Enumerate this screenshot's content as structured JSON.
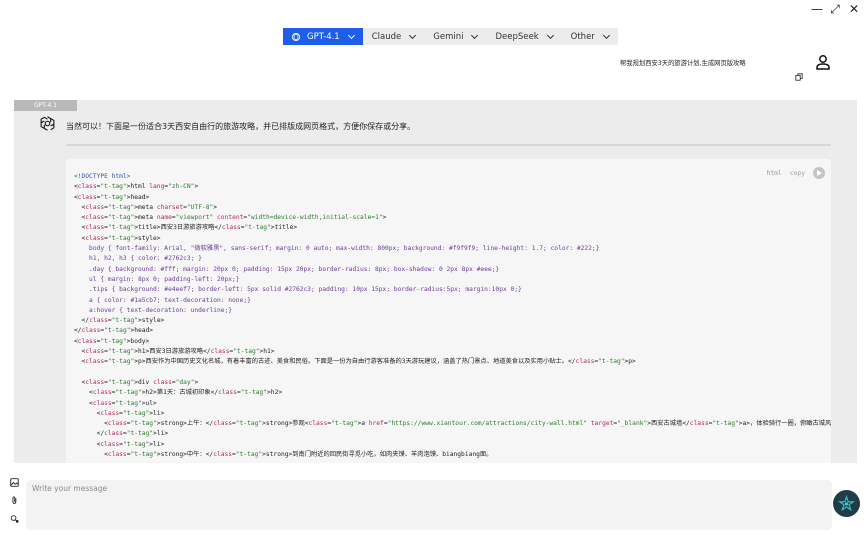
{
  "window_controls": {
    "minimize": "—",
    "maximize": "⤢",
    "close": "✕"
  },
  "model_tabs": [
    {
      "label": "GPT-4.1",
      "active": true
    },
    {
      "label": "Claude",
      "active": false
    },
    {
      "label": "Gemini",
      "active": false
    },
    {
      "label": "DeepSeek",
      "active": false
    },
    {
      "label": "Other",
      "active": false
    }
  ],
  "user_message": "帮我规划西安3天的旅游计划,生成网页版攻略",
  "response": {
    "model_label": "GPT-4.1",
    "intro": "当然可以！下面是一份适合3天西安自由行的旅游攻略，并已排版成网页格式，方便你保存或分享。",
    "code": {
      "lang": "html",
      "copy_label": "copy",
      "lines": [
        "<!DOCTYPE html>",
        "<html lang=\"zh-CN\">",
        "<head>",
        "  <meta charset=\"UTF-8\">",
        "  <meta name=\"viewport\" content=\"width=device-width,initial-scale=1\">",
        "  <title>西安3日游旅游攻略</title>",
        "  <style>",
        "    body { font-family: Arial, \"微软雅黑\", sans-serif; margin: 0 auto; max-width: 800px; background: #f9f9f9; line-height: 1.7; color: #222;}",
        "    h1, h2, h3 { color: #2762c3; }",
        "    .day { background: #fff; margin: 20px 0; padding: 15px 20px; border-radius: 8px; box-shadow: 0 2px 8px #eee;}",
        "    ul { margin: 8px 0; padding-left: 20px;}",
        "    .tips { background: #e4eef7; border-left: 5px solid #2762c3; padding: 10px 15px; border-radius:5px; margin:10px 0;}",
        "    a { color: #1a5cb7; text-decoration: none;}",
        "    a:hover { text-decoration: underline;}",
        "  </style>",
        "</head>",
        "<body>",
        "  <h1>西安3日游旅游攻略</h1>",
        "  <p>西安作为中国历史文化名城，有着丰富的古迹、美食和民俗。下面是一份为自由行游客准备的3天游玩建议，涵盖了热门景点、地道美食以及实用小贴士。</p>",
        "",
        "  <div class=\"day\">",
        "    <h2>第1天：古城初印象</h2>",
        "    <ul>",
        "      <li>",
        "        <strong>上午：</strong>参观<a href=\"https://www.xiantour.com/attractions/city-wall.html\" target=\"_blank\">西安古城墙</a>，体验骑行一圈，俯瞰古城风貌。",
        "      </li>",
        "      <li>",
        "        <strong>中午：</strong>到南门附近的回民街寻觅小吃，如肉夹馍、羊肉泡馍、biangbiang面。"
      ]
    }
  },
  "composer": {
    "placeholder": "Write your message"
  },
  "colors": {
    "accent": "#1e5ee8",
    "panel": "#ececec",
    "send_button": "#1f3d47"
  }
}
